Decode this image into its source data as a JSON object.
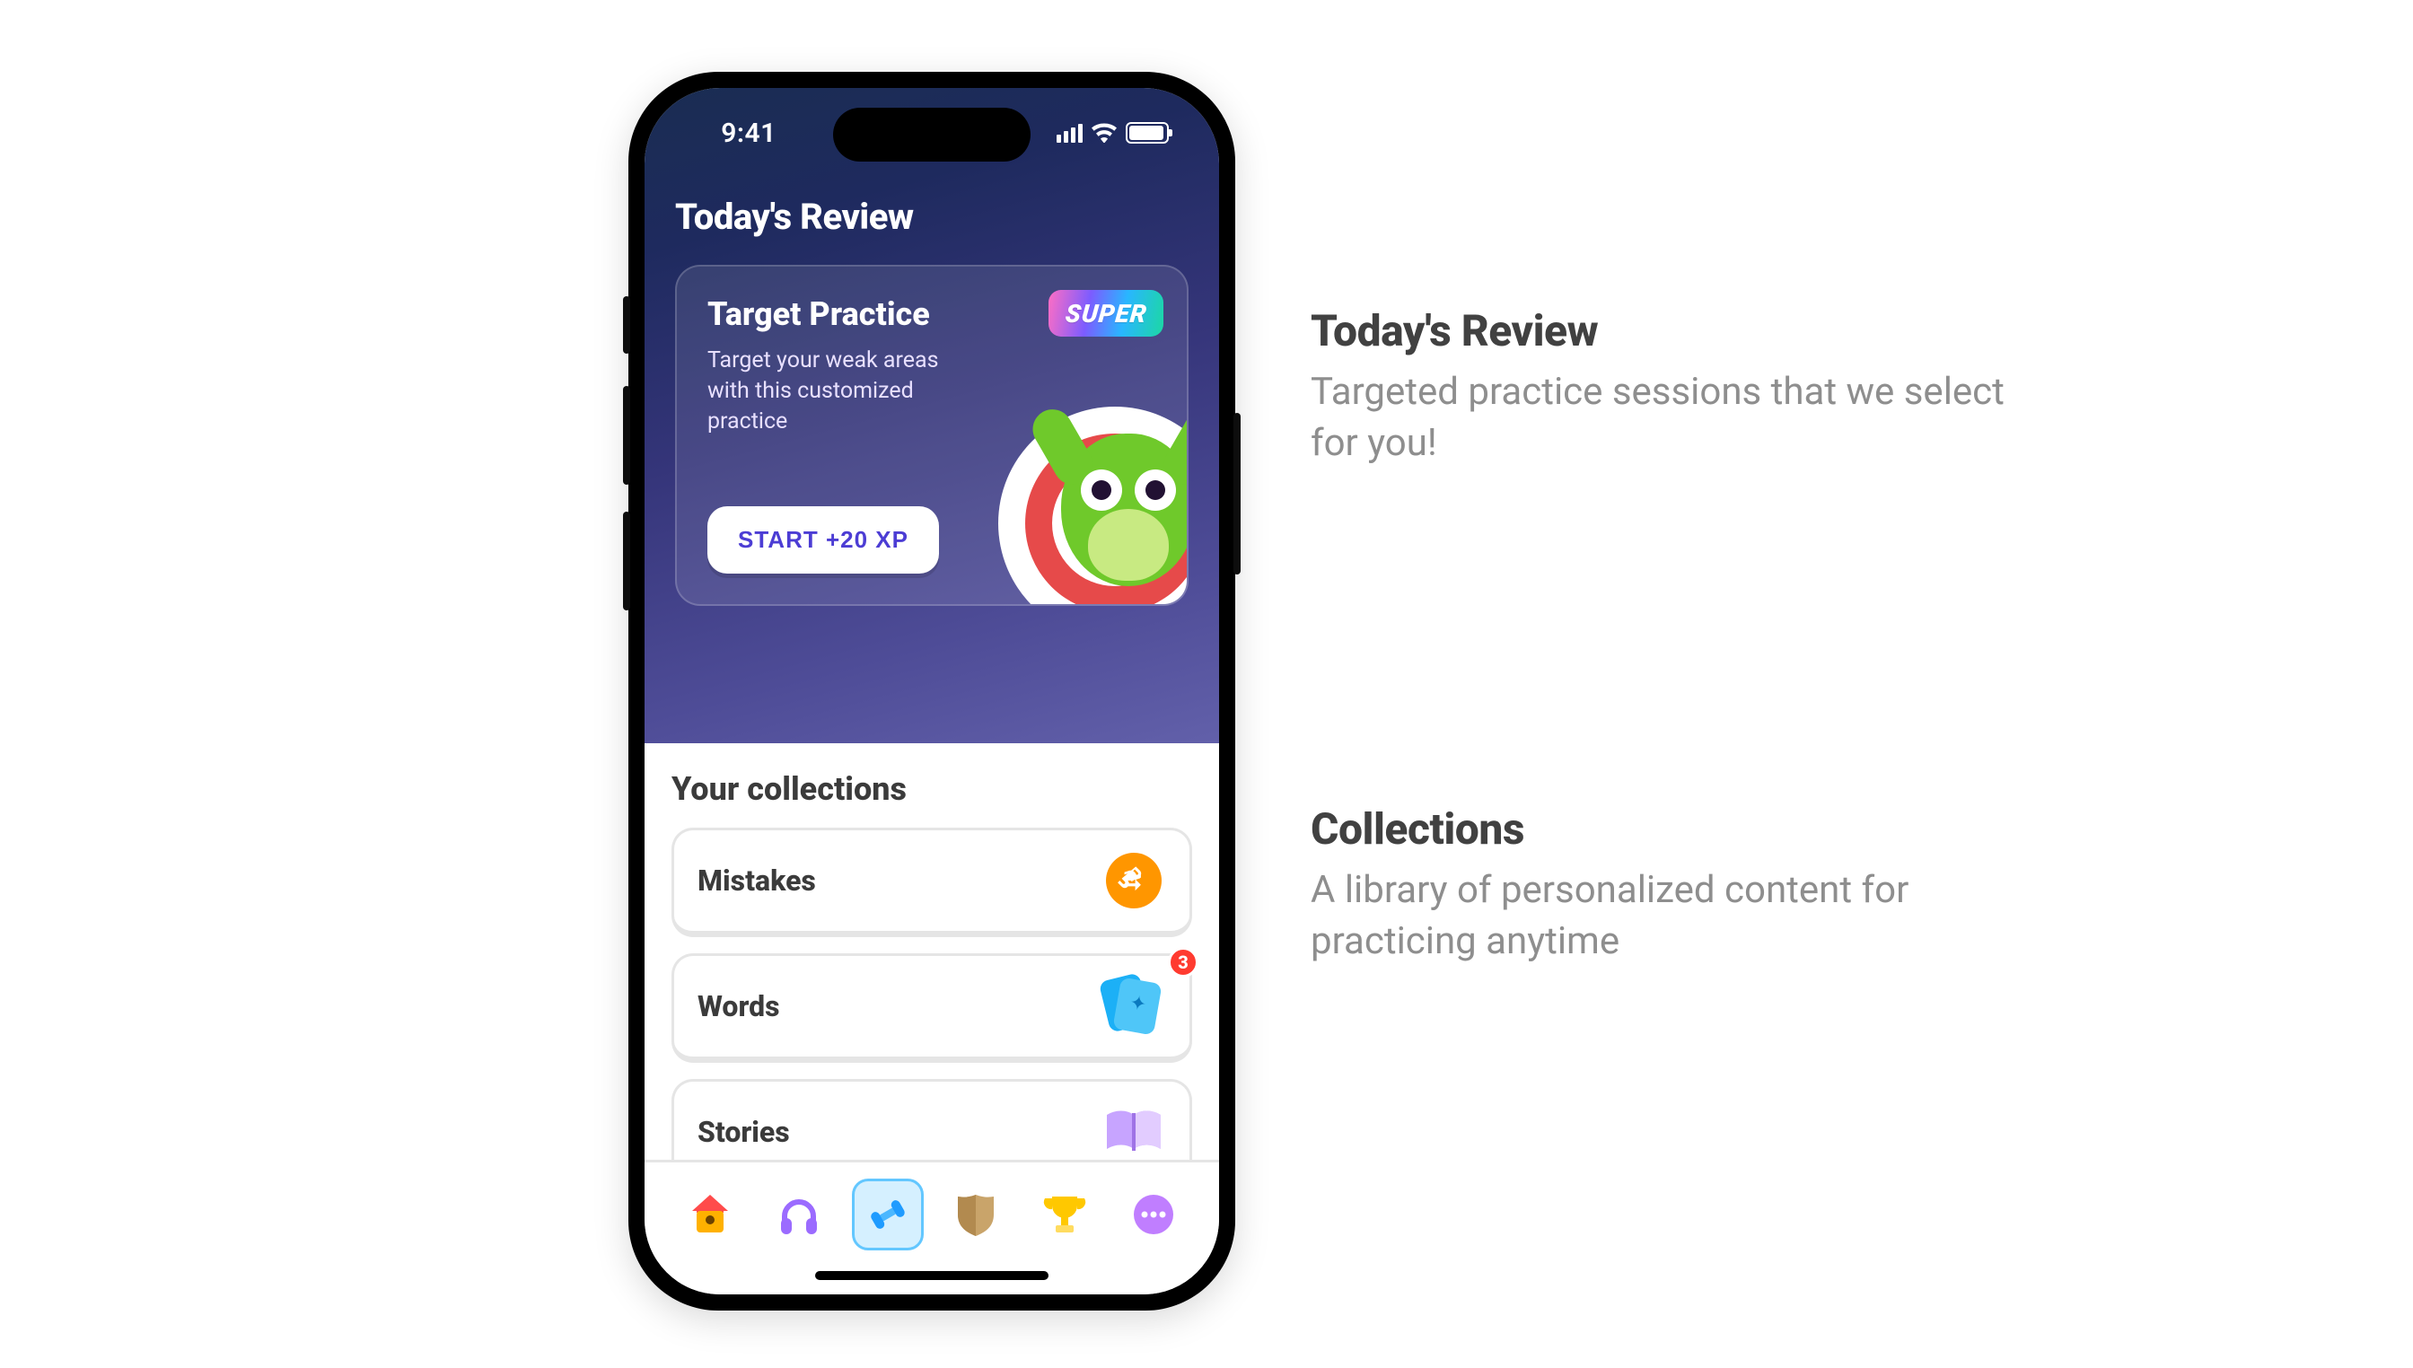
{
  "status": {
    "time": "9:41"
  },
  "hero": {
    "title": "Today's Review",
    "card": {
      "title": "Target Practice",
      "desc": "Target your weak areas with this customized practice",
      "button": "START +20 XP",
      "badge": "SUPER"
    }
  },
  "collections": {
    "title": "Your collections",
    "items": [
      {
        "label": "Mistakes"
      },
      {
        "label": "Words",
        "badge": "3"
      },
      {
        "label": "Stories"
      }
    ]
  },
  "annotations": {
    "review": {
      "title": "Today's Review",
      "body": "Targeted practice sessions that we select for you!"
    },
    "collections": {
      "title": "Collections",
      "body": "A library of personalized content for practicing anytime"
    }
  }
}
